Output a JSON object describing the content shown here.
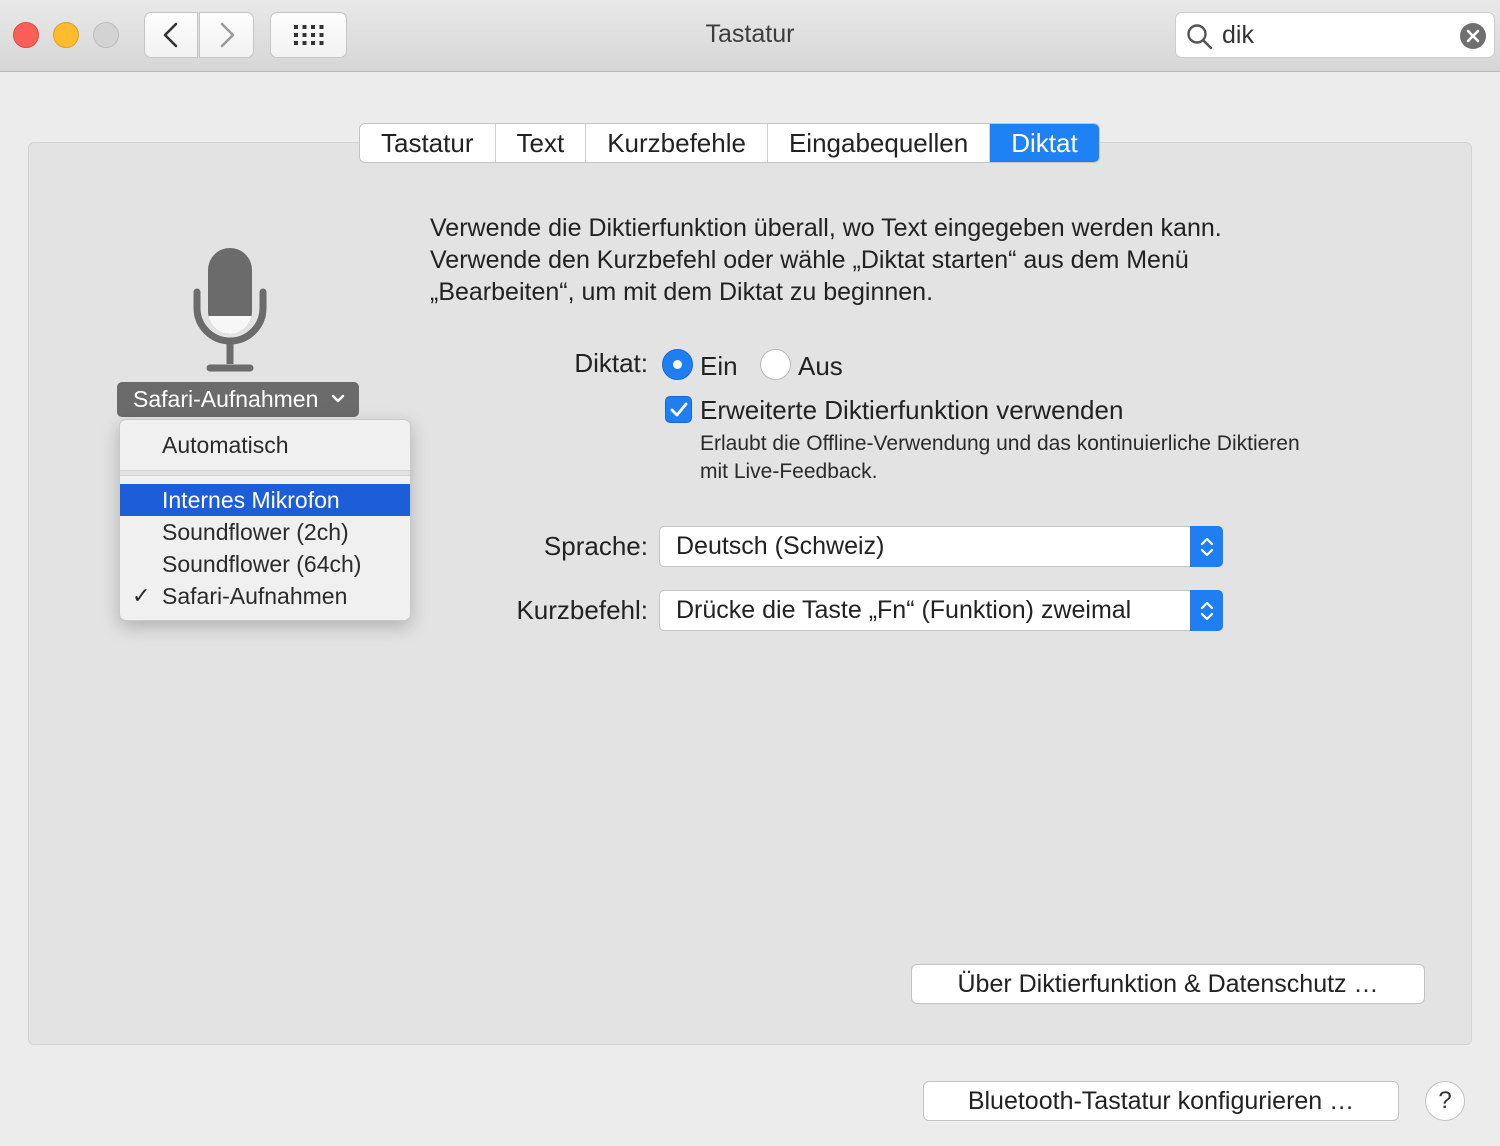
{
  "window": {
    "title": "Tastatur",
    "search": {
      "value": "dik",
      "placeholder": "Suchen"
    }
  },
  "tabs": [
    {
      "label": "Tastatur",
      "active": false
    },
    {
      "label": "Text",
      "active": false
    },
    {
      "label": "Kurzbefehle",
      "active": false
    },
    {
      "label": "Eingabequellen",
      "active": false
    },
    {
      "label": "Diktat",
      "active": true
    }
  ],
  "mic_source": {
    "selected": "Safari-Aufnahmen",
    "menu": {
      "items": [
        {
          "label": "Automatisch",
          "highlighted": false,
          "checked": false
        },
        {
          "label": "Internes Mikrofon",
          "highlighted": true,
          "checked": false
        },
        {
          "label": "Soundflower (2ch)",
          "highlighted": false,
          "checked": false
        },
        {
          "label": "Soundflower (64ch)",
          "highlighted": false,
          "checked": false
        },
        {
          "label": "Safari-Aufnahmen",
          "highlighted": false,
          "checked": true
        }
      ],
      "check_glyph": "✓"
    }
  },
  "description": {
    "line1": "Verwende die Diktierfunktion überall, wo Text eingegeben werden kann.",
    "line2": "Verwende den Kurzbefehl oder wähle „Diktat starten“ aus dem Menü",
    "line3": "„Bearbeiten“, um mit dem Diktat zu beginnen."
  },
  "dictation": {
    "label": "Diktat:",
    "on_label": "Ein",
    "off_label": "Aus",
    "state": "Ein"
  },
  "enhanced": {
    "label": "Erweiterte Diktierfunktion verwenden",
    "checked": true,
    "desc_line1": "Erlaubt die Offline-Verwendung und das kontinuierliche Diktieren",
    "desc_line2": "mit Live-Feedback."
  },
  "language": {
    "label": "Sprache:",
    "value": "Deutsch (Schweiz)"
  },
  "shortcut": {
    "label": "Kurzbefehl:",
    "value": "Drücke die Taste „Fn“ (Funktion) zweimal"
  },
  "buttons": {
    "about": "Über Diktierfunktion & Datenschutz …",
    "bluetooth": "Bluetooth-Tastatur konfigurieren …",
    "help": "?"
  },
  "colors": {
    "accent": "#1f7ff2",
    "menu_highlight": "#1c5ed8",
    "close": "#fc5f57",
    "minimize": "#fdbc2e"
  }
}
